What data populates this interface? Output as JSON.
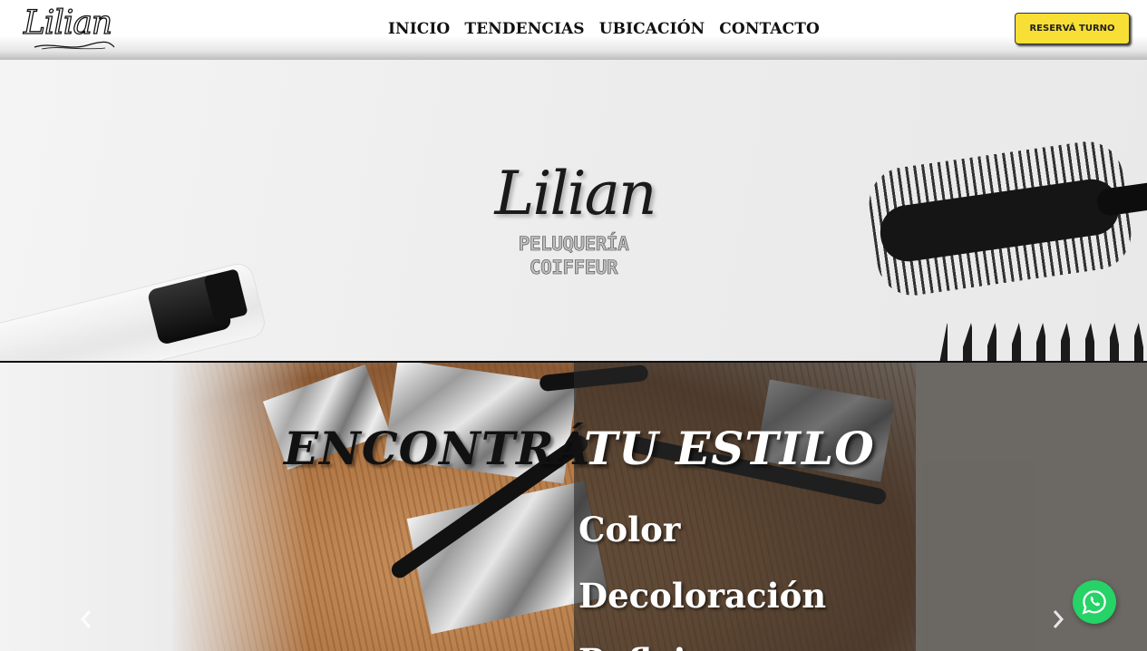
{
  "navbar": {
    "brand": "Lilian",
    "menu": [
      {
        "label": "INICIO"
      },
      {
        "label": "TENDENCIAS"
      },
      {
        "label": "UBICACIÓN"
      },
      {
        "label": "CONTACTO"
      }
    ],
    "cta_label": "RESERVÁ TURNO",
    "cta_color": "#f7df36"
  },
  "hero": {
    "logo_text": "Lilian",
    "subtitle_line1": "PELUQUERÍA",
    "subtitle_line2": "COIFFEUR"
  },
  "carousel": {
    "headline_left": "ENCONTRÁ",
    "headline_right": "TU ESTILO",
    "services": [
      "Color",
      "Decoloración",
      "Reflejos"
    ],
    "prev_icon": "chevron-left-icon",
    "next_icon": "chevron-right-icon"
  },
  "whatsapp": {
    "icon": "whatsapp-icon",
    "color": "#25d366"
  }
}
